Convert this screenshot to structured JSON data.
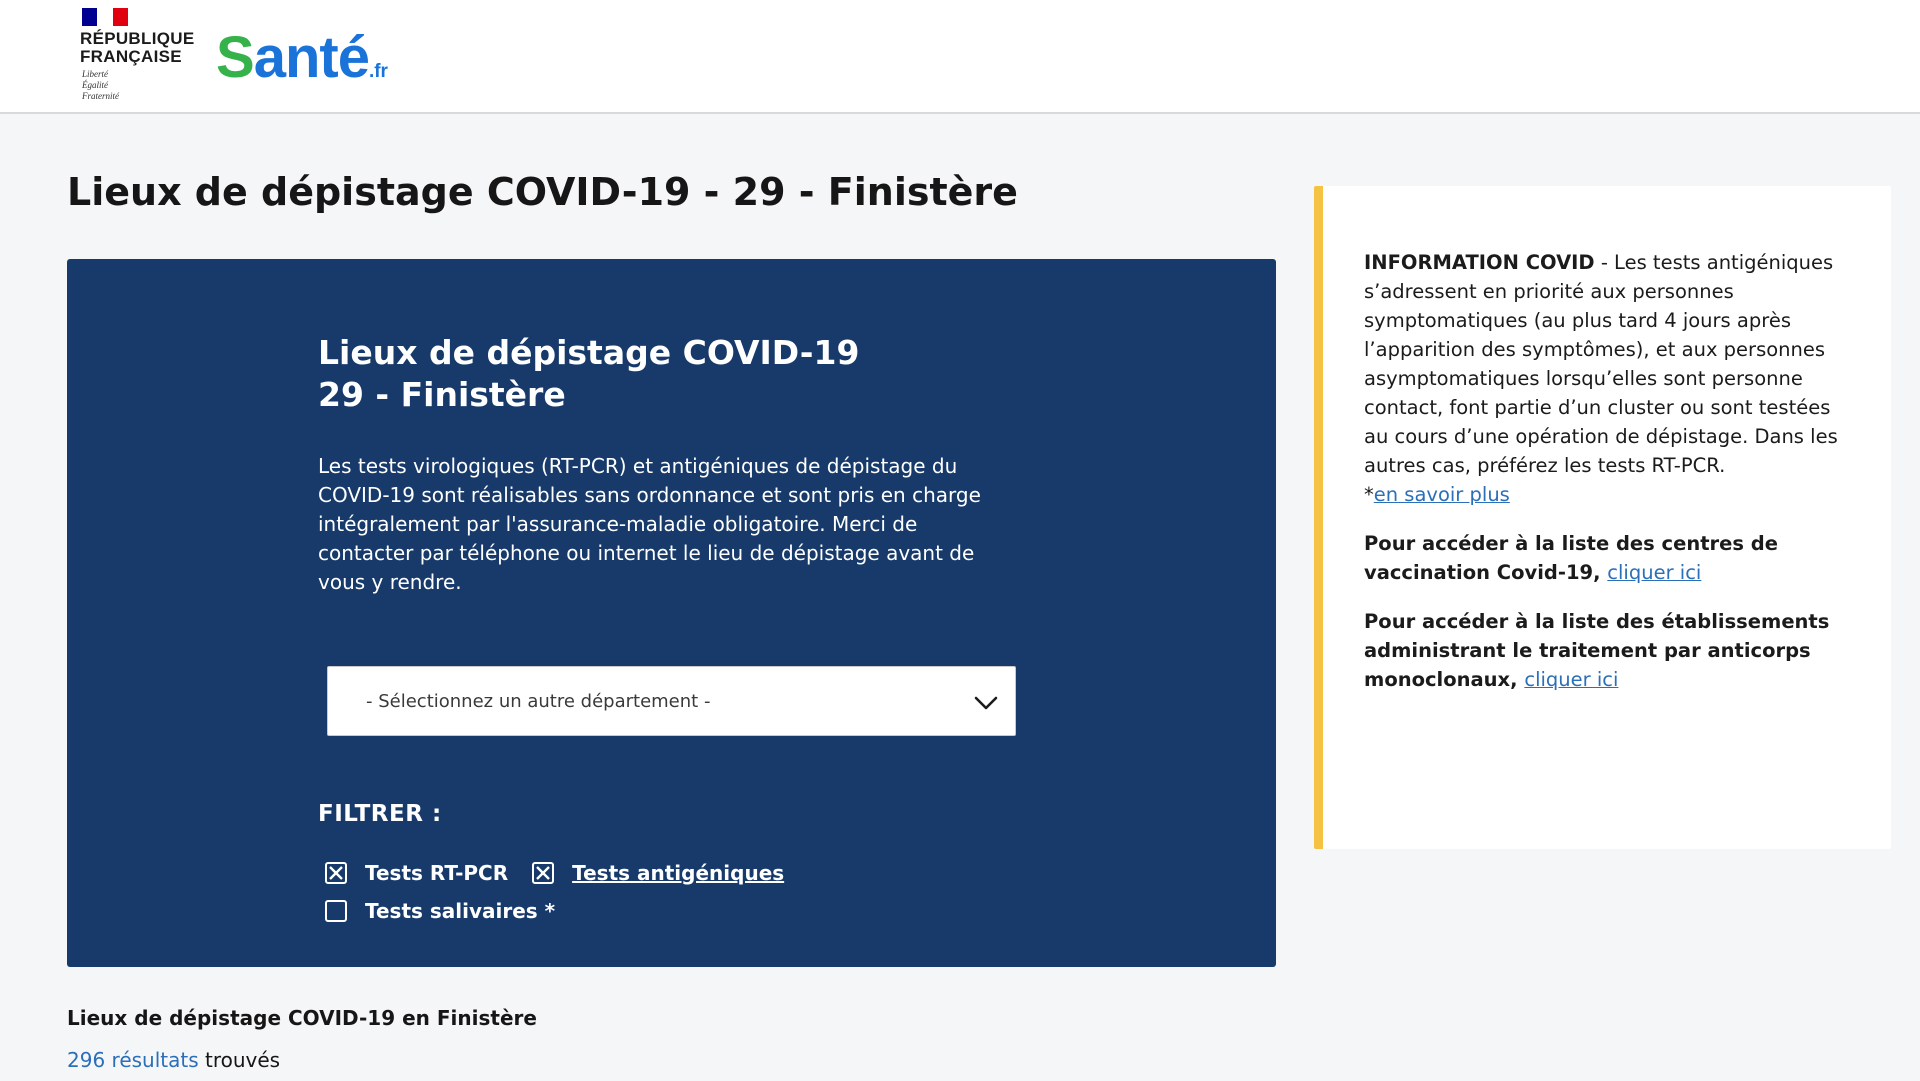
{
  "header": {
    "gov_logo": {
      "name_line1": "RÉPUBLIQUE",
      "name_line2": "FRANÇAISE",
      "motto": [
        "Liberté",
        "Égalité",
        "Fraternité"
      ]
    },
    "site_logo": {
      "brand": "Santé",
      "tld": ".fr"
    }
  },
  "page_title": "Lieux de dépistage COVID-19 - 29 - Finistère",
  "panel": {
    "title_line1": "Lieux de dépistage COVID-19",
    "title_line2": "29 - Finistère",
    "description": "Les tests virologiques (RT-PCR) et antigéniques de dépistage du COVID-19 sont réalisables sans ordonnance et sont pris en charge intégralement par l'assurance-maladie obligatoire. Merci de contacter par téléphone ou internet le lieu de dépistage avant de vous y rendre.",
    "department_select": {
      "value": "- Sélectionnez un autre département -",
      "icon": "chevron-down-icon"
    },
    "filter_label": "FILTRER :",
    "filters": [
      {
        "label": "Tests RT-PCR",
        "checked": true
      },
      {
        "label": "Tests antigéniques",
        "checked": true
      },
      {
        "label": "Tests salivaires *",
        "checked": false
      }
    ]
  },
  "results": {
    "heading": "Lieux de dépistage COVID-19 en Finistère",
    "count": "296 résultats",
    "count_suffix": " trouvés"
  },
  "info": {
    "p1_strong": "INFORMATION COVID",
    "p1_text": " - Les tests antigéniques s’adressent en priorité aux personnes symptomatiques (au plus tard 4 jours après l’apparition des symptômes), et aux personnes asymptomatiques lorsqu’elles sont personne contact, font partie d’un cluster ou sont testées au cours d’une opération de dépistage. Dans les autres cas, préférez les tests RT-PCR.",
    "p1_link_prefix": "*",
    "p1_link": "en savoir plus",
    "p2_text": "Pour accéder à la liste des centres de vaccination Covid-19, ",
    "p2_link": "cliquer ici",
    "p3_text": "Pour accéder à la liste des établissements administrant le traitement par anticorps monoclonaux, ",
    "p3_link": "cliquer ici"
  },
  "colors": {
    "panel_bg": "#173a6b",
    "accent_border": "#f5c242",
    "link": "#2a6fb8",
    "sante_green": "#35b24a",
    "sante_blue": "#1a73d9"
  }
}
